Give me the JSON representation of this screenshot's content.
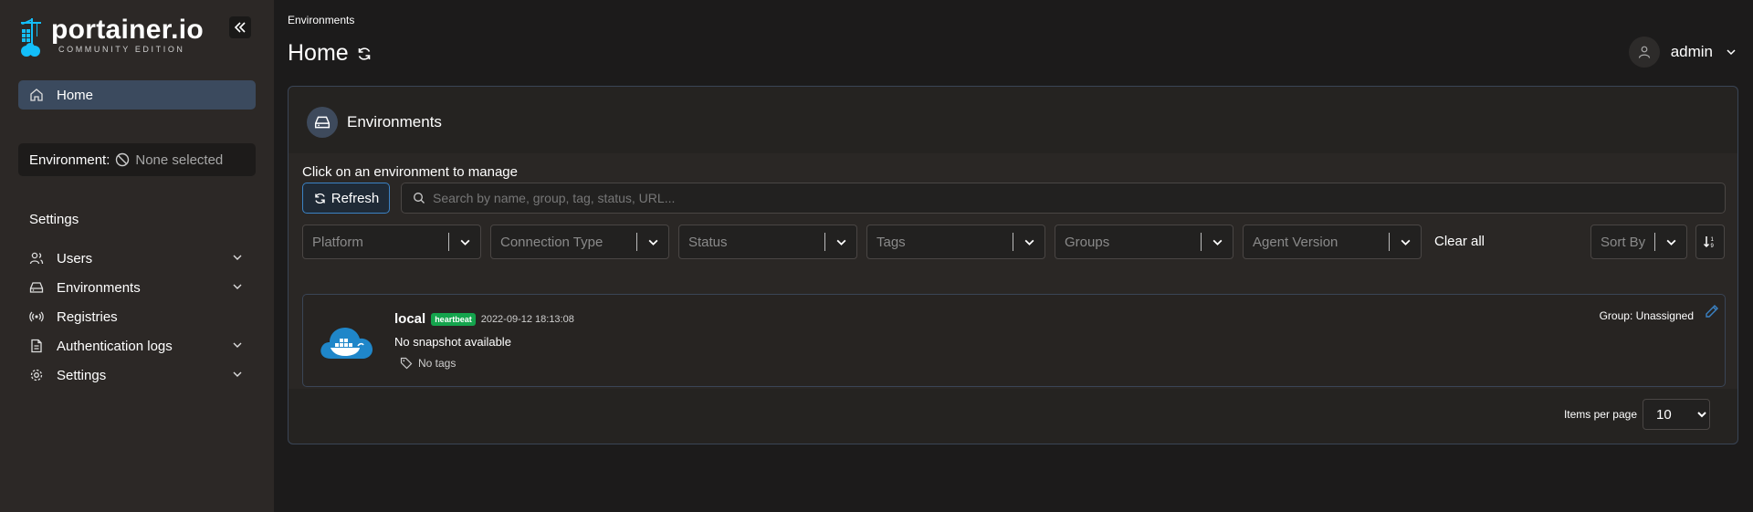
{
  "brand": {
    "name": "portainer.io",
    "edition": "COMMUNITY EDITION",
    "color": "#13bef9"
  },
  "sidebar": {
    "home_label": "Home",
    "environment_label": "Environment:",
    "environment_value": "None selected",
    "settings_heading": "Settings",
    "items": [
      {
        "label": "Users",
        "icon": "users-icon",
        "expandable": true
      },
      {
        "label": "Environments",
        "icon": "hdd-icon",
        "expandable": true
      },
      {
        "label": "Registries",
        "icon": "radio-icon",
        "expandable": false
      },
      {
        "label": "Authentication logs",
        "icon": "file-icon",
        "expandable": true
      },
      {
        "label": "Settings",
        "icon": "gear-icon",
        "expandable": true
      }
    ]
  },
  "header": {
    "breadcrumb": "Environments",
    "title": "Home",
    "user": "admin"
  },
  "panel": {
    "title": "Environments",
    "instruction": "Click on an environment to manage",
    "refresh_label": "Refresh",
    "search_placeholder": "Search by name, group, tag, status, URL...",
    "filters": [
      "Platform",
      "Connection Type",
      "Status",
      "Tags",
      "Groups",
      "Agent Version"
    ],
    "clear_all": "Clear all",
    "sort_by": "Sort By"
  },
  "environments": [
    {
      "name": "local",
      "status_badge": "heartbeat",
      "timestamp": "2022-09-12 18:13:08",
      "snapshot": "No snapshot available",
      "tags": "No tags",
      "group": "Group: Unassigned"
    }
  ],
  "pagination": {
    "label": "Items per page",
    "value": "10"
  },
  "colors": {
    "accent": "#3b82c4",
    "badge": "#14a44d",
    "active_nav": "#3b4a5e"
  }
}
